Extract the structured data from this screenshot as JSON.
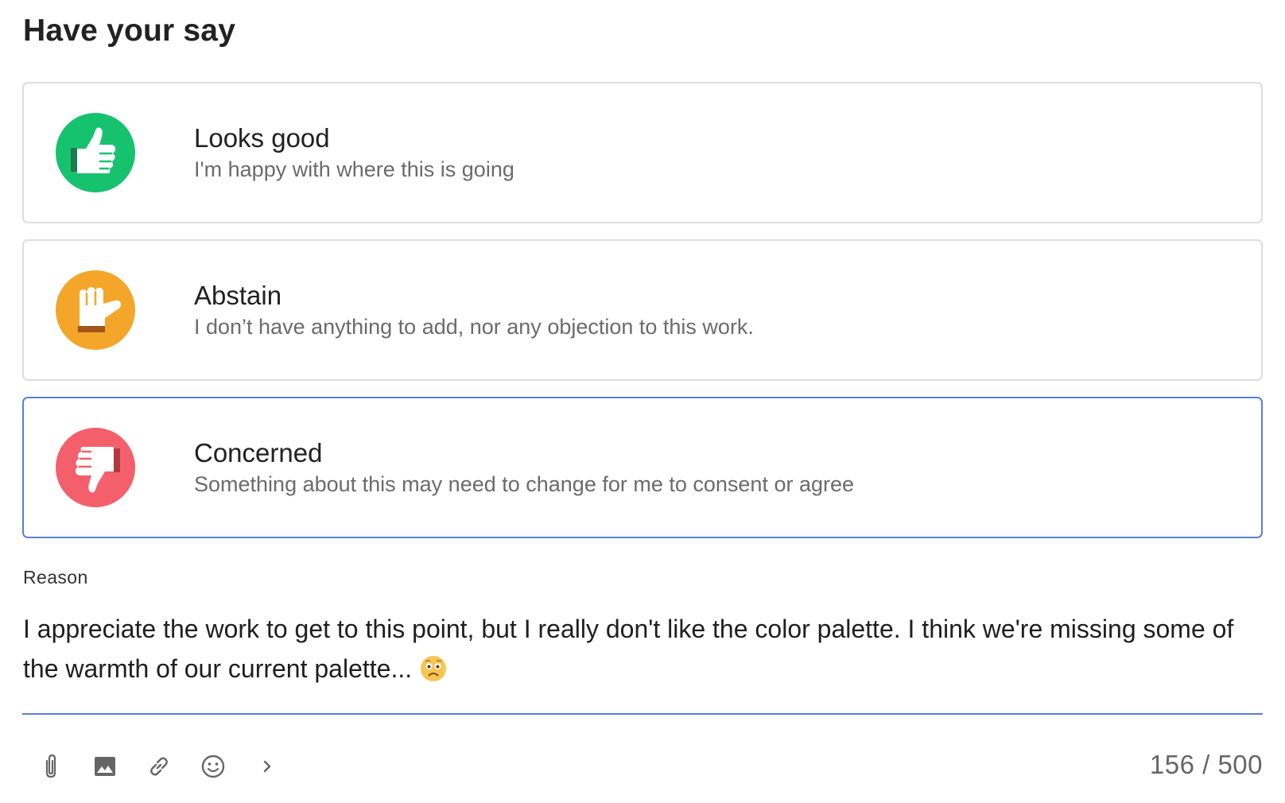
{
  "page": {
    "title": "Have your say"
  },
  "options": [
    {
      "label": "Looks good",
      "description": "I'm happy with where this is going",
      "icon": "thumbs-up-icon",
      "color": "#17c26f",
      "selected": false
    },
    {
      "label": "Abstain",
      "description": "I don’t have anything to add, nor any objection to this work.",
      "icon": "hand-sideways-icon",
      "color": "#f4a62a",
      "selected": false
    },
    {
      "label": "Concerned",
      "description": "Something about this may need to change for me to consent or agree",
      "icon": "thumbs-down-icon",
      "color": "#f35f6a",
      "selected": true
    }
  ],
  "reason": {
    "label": "Reason",
    "value": "I appreciate the work to get to this point, but I really don't like the color palette. I think we're missing some of the warmth of our current palette...",
    "emoji": "worried-face-emoji"
  },
  "toolbar": {
    "buttons": [
      "attachment-icon",
      "image-icon",
      "link-icon",
      "emoji-icon",
      "chevron-right-icon"
    ]
  },
  "counter": {
    "text": "156 / 500"
  },
  "colors": {
    "accent": "#5b7fd6",
    "border": "#dedede"
  }
}
